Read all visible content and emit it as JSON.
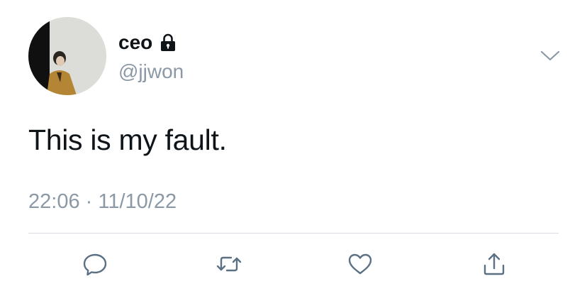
{
  "user": {
    "display_name": "ceo",
    "handle": "@jjwon",
    "protected": true,
    "avatar_icon": "profile-photo"
  },
  "tweet": {
    "text": "This is my fault.",
    "time": "22:06",
    "separator": "·",
    "date": "11/10/22"
  },
  "actions": {
    "reply_icon": "speech-bubble-icon",
    "retweet_icon": "retweet-arrows-icon",
    "like_icon": "heart-icon",
    "share_icon": "share-upload-icon"
  },
  "colors": {
    "text_primary": "#0f1419",
    "text_secondary": "#8b98a5",
    "divider": "#d7dde2"
  }
}
